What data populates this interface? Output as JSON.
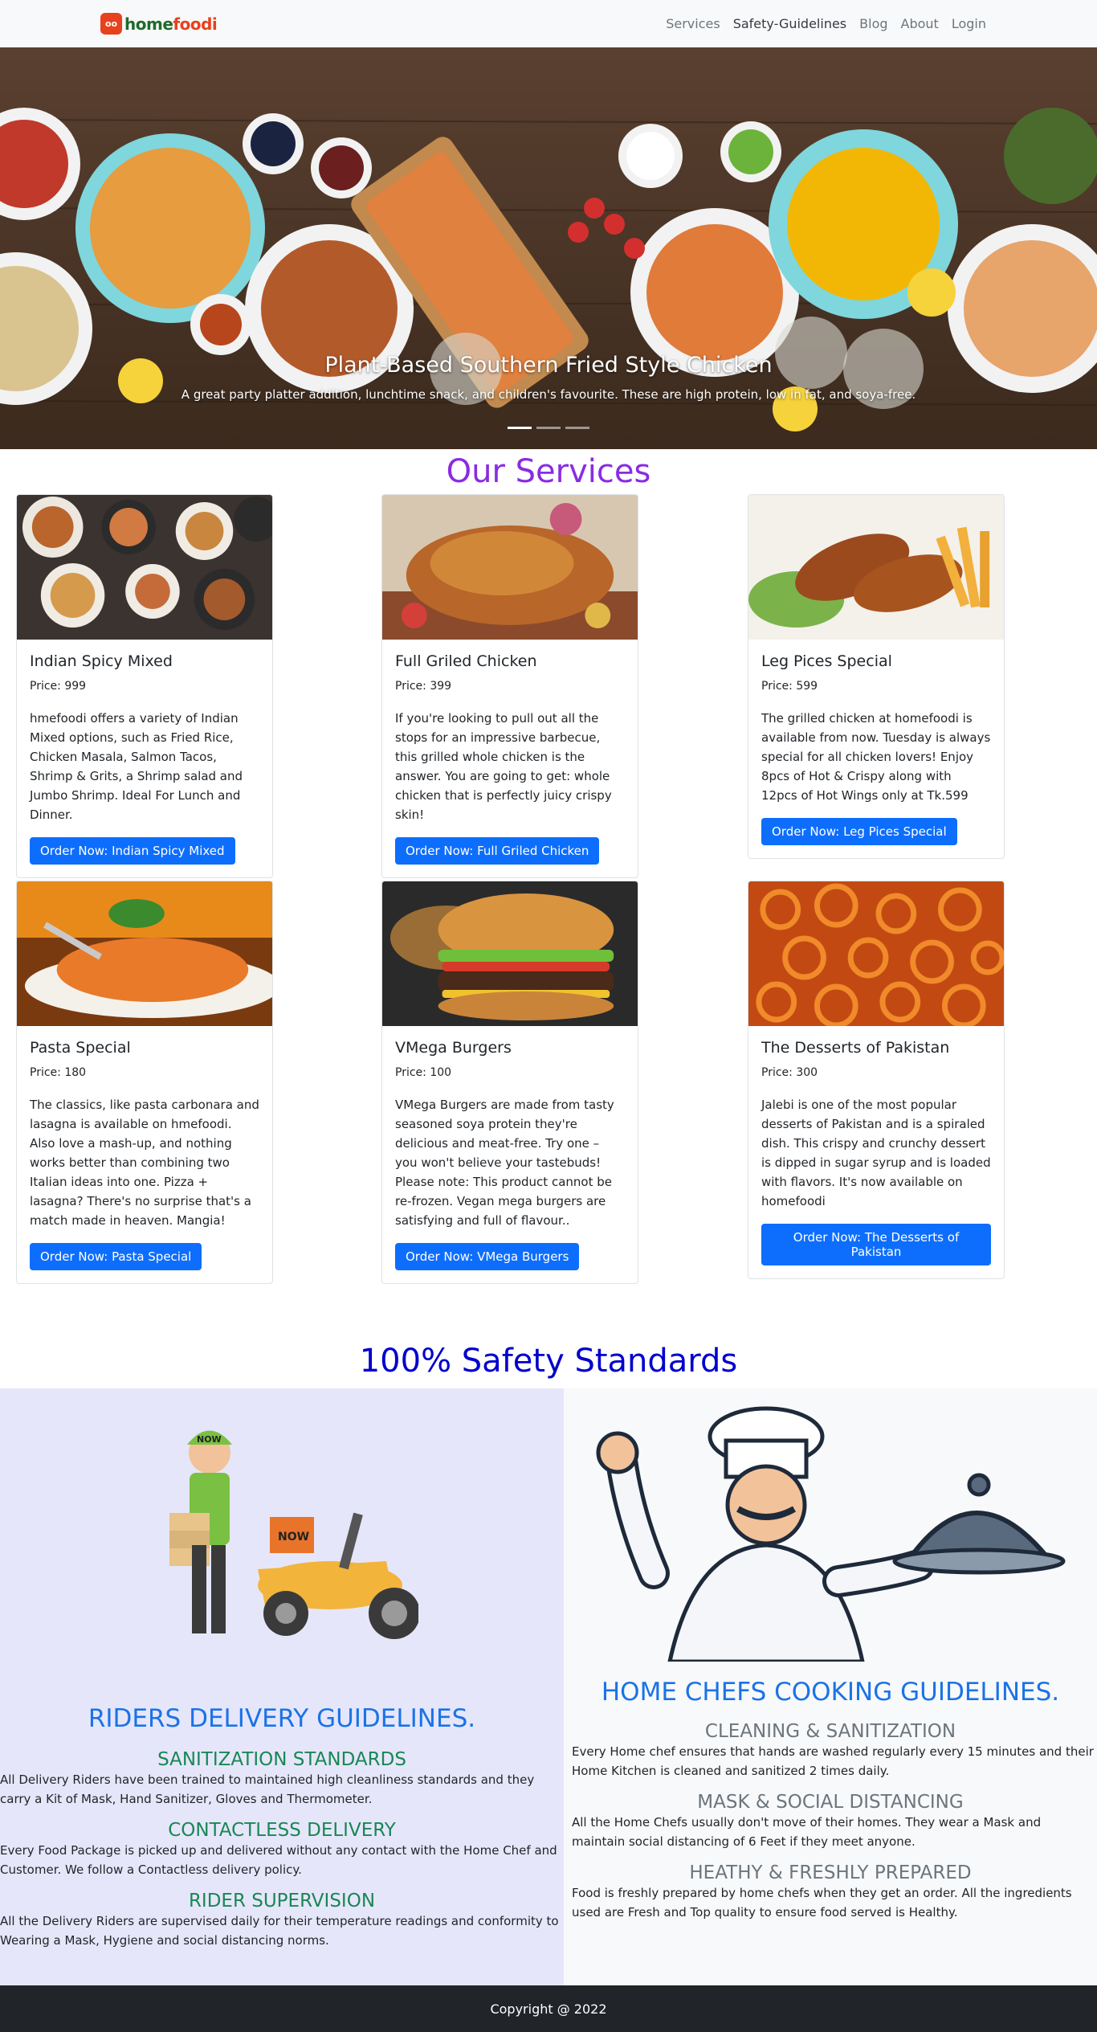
{
  "nav": {
    "brand_mark": "oo",
    "brand_name_part1": "home",
    "brand_name_part2": "foodi",
    "links": [
      "Services",
      "Safety-Guidelines",
      "Blog",
      "About",
      "Login"
    ]
  },
  "hero": {
    "title": "Plant-Based Southern Fried Style Chicken",
    "text": "A great party platter addition, lunchtime snack, and children's favourite. These are high protein, low in fat, and soya-free."
  },
  "services": {
    "title": "Our Services",
    "cards": [
      {
        "title": "Indian Spicy Mixed",
        "price": "Price: 999",
        "text": "hmefoodi offers a variety of Indian Mixed options, such as Fried Rice, Chicken Masala, Salmon Tacos, Shrimp & Grits, a Shrimp salad and Jumbo Shrimp. Ideal For Lunch and Dinner.",
        "button": "Order Now: Indian Spicy Mixed"
      },
      {
        "title": "Full Griled Chicken",
        "price": "Price: 399",
        "text": "If you're looking to pull out all the stops for an impressive barbecue, this grilled whole chicken is the answer. You are going to get: whole chicken that is perfectly juicy crispy skin!",
        "button": "Order Now: Full Griled Chicken"
      },
      {
        "title": "Leg Pices Special",
        "price": "Price: 599",
        "text": "The grilled chicken at homefoodi is available from now. Tuesday is always special for all chicken lovers! Enjoy 8pcs of Hot & Crispy along with 12pcs of Hot Wings only at Tk.599",
        "button": "Order Now: Leg Pices Special"
      },
      {
        "title": "Pasta Special",
        "price": "Price: 180",
        "text": "The classics, like pasta carbonara and lasagna is available on hmefoodi. Also love a mash-up, and nothing works better than combining two Italian ideas into one. Pizza + lasagna? There's no surprise that's a match made in heaven. Mangia!",
        "button": "Order Now: Pasta Special"
      },
      {
        "title": "VMega Burgers",
        "price": "Price: 100",
        "text": "VMega Burgers are made from tasty seasoned soya protein they're delicious and meat-free. Try one – you won't believe your tastebuds! Please note: This product cannot be re-frozen. Vegan mega burgers are satisfying and full of flavour..",
        "button": "Order Now: VMega Burgers"
      },
      {
        "title": "The Desserts of Pakistan",
        "price": "Price: 300",
        "text": "Jalebi is one of the most popular desserts of Pakistan and is a spiraled dish. This crispy and crunchy dessert is dipped in sugar syrup and is loaded with flavors. It's now available on homefoodi",
        "button": "Order Now: The Desserts of Pakistan"
      }
    ]
  },
  "safety": {
    "title": "100% Safety Standards",
    "riders": {
      "badge_cap": "NOW",
      "badge_box": "NOW",
      "heading": "RIDERS DELIVERY GUIDELINES.",
      "items": [
        {
          "title": "SANITIZATION STANDARDS",
          "text": "All Delivery Riders have been trained to maintained high cleanliness standards and they carry a Kit of Mask, Hand Sanitizer, Gloves and Thermometer."
        },
        {
          "title": "CONTACTLESS DELIVERY",
          "text": "Every Food Package is picked up and delivered without any contact with the Home Chef and Customer. We follow a Contactless delivery policy."
        },
        {
          "title": "RIDER SUPERVISION",
          "text": "All the Delivery Riders are supervised daily for their temperature readings and conformity to Wearing a Mask, Hygiene and social distancing norms."
        }
      ]
    },
    "chefs": {
      "heading": "HOME CHEFS COOKING GUIDELINES.",
      "items": [
        {
          "title": "CLEANING & SANITIZATION",
          "text": "Every Home chef ensures that hands are washed regularly every 15 minutes and their Home Kitchen is cleaned and sanitized 2 times daily."
        },
        {
          "title": "MASK & SOCIAL DISTANCING",
          "text": "All the Home Chefs usually don't move of their homes. They wear a Mask and maintain social distancing of 6 Feet if they meet anyone."
        },
        {
          "title": "HEATHY & FRESHLY PREPARED",
          "text": "Food is freshly prepared by home chefs when they get an order. All the ingredients used are Fresh and Top quality to ensure food served is Healthy."
        }
      ]
    }
  },
  "footer": {
    "text": "Copyright @ 2022"
  }
}
